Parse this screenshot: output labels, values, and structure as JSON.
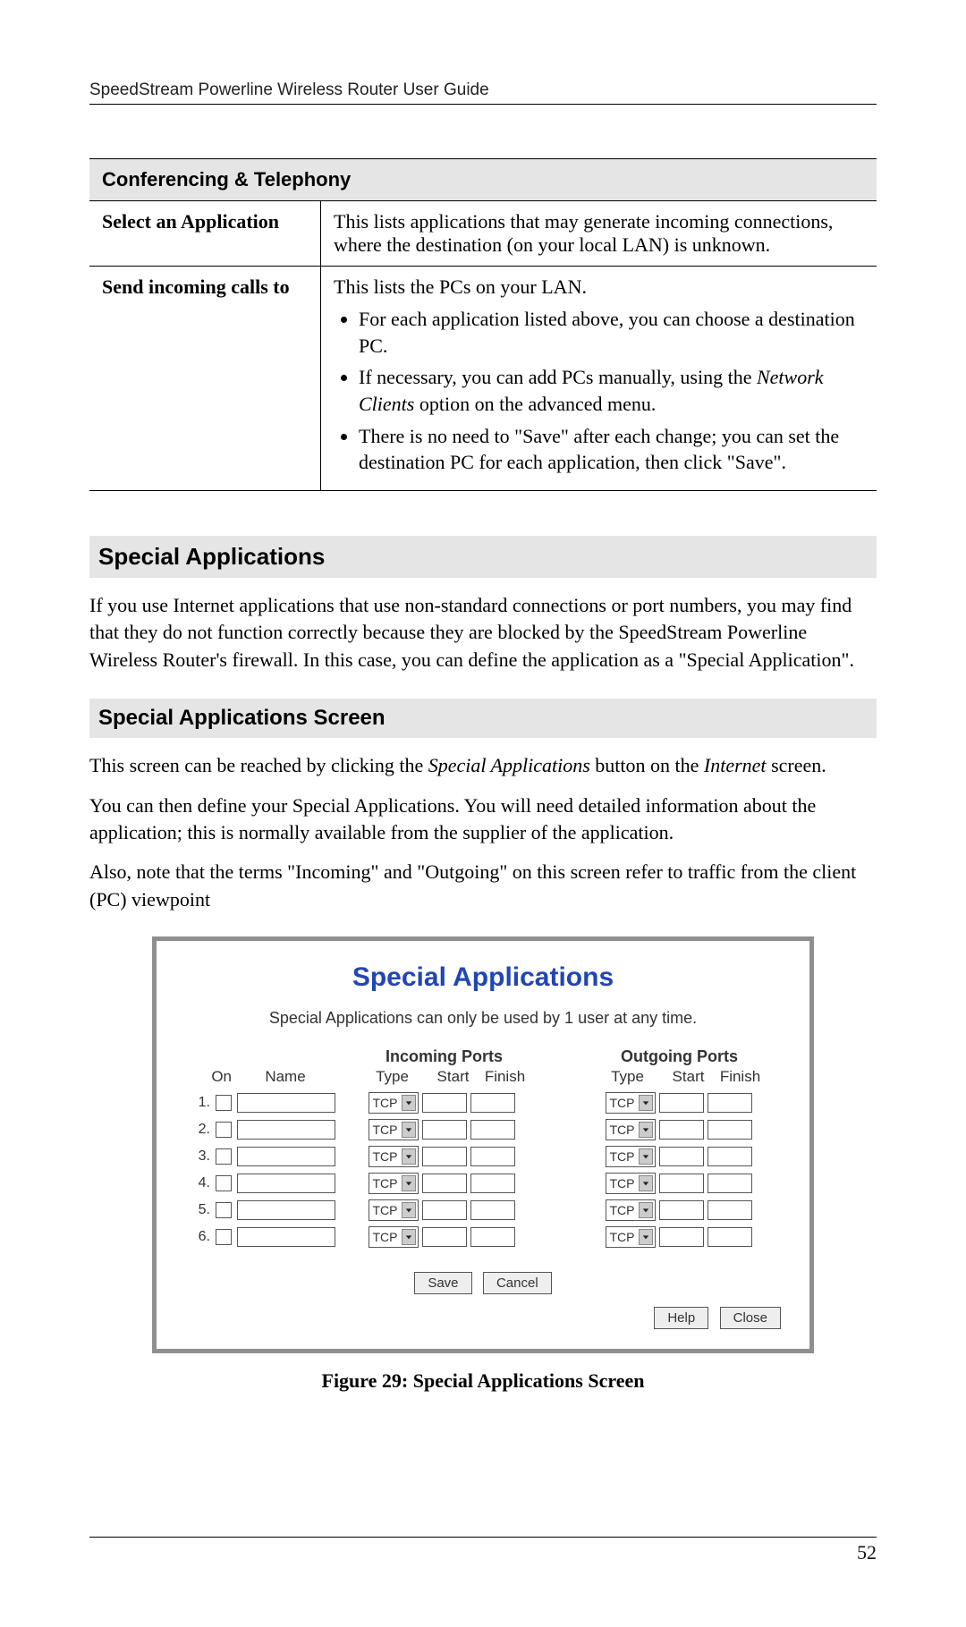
{
  "header": "SpeedStream Powerline Wireless Router User Guide",
  "pageNumber": "52",
  "table": {
    "sectionTitle": "Conferencing & Telephony",
    "rows": [
      {
        "term": "Select an Application",
        "desc": "This lists applications that may generate incoming connections, where the destination (on your local LAN) is unknown."
      },
      {
        "term": "Send incoming calls to",
        "intro": "This lists the PCs on your LAN.",
        "bullets": [
          {
            "pre": "For each application listed above, you can choose a destination PC."
          },
          {
            "pre": "If necessary, you can add PCs manually, using the ",
            "it": "Network Clients",
            "post": " option on the advanced menu."
          },
          {
            "pre": "There is no need to \"Save\" after each change; you can set the destination PC for each application, then click \"Save\"."
          }
        ]
      }
    ]
  },
  "sections": {
    "h1": "Special Applications",
    "p1": "If you use Internet applications that use non-standard connections or port numbers, you may find that they do not function correctly because they are blocked by the SpeedStream Powerline Wireless Router's firewall. In this case, you can define the application as a \"Special Application\".",
    "h2": "Special Applications Screen",
    "p2a": "This screen can be reached by clicking the ",
    "p2it1": "Special Applications",
    "p2b": " button on the ",
    "p2it2": "Internet",
    "p2c": " screen.",
    "p3": "You can then define your Special Applications. You will need detailed information about the application; this is normally available from the supplier of the application.",
    "p4": "Also, note that the terms \"Incoming\" and \"Outgoing\" on this screen refer to traffic from the client (PC) viewpoint"
  },
  "shot": {
    "title": "Special Applications",
    "note": "Special Applications can only be used by 1 user at any time.",
    "incoming": "Incoming Ports",
    "outgoing": "Outgoing Ports",
    "onLabel": "On",
    "nameLabel": "Name",
    "typeLabel": "Type",
    "startLabel": "Start",
    "finishLabel": "Finish",
    "tcp": "TCP",
    "rowNumbers": [
      "1.",
      "2.",
      "3.",
      "4.",
      "5.",
      "6."
    ],
    "save": "Save",
    "cancel": "Cancel",
    "help": "Help",
    "close": "Close"
  },
  "caption": "Figure 29: Special Applications Screen"
}
